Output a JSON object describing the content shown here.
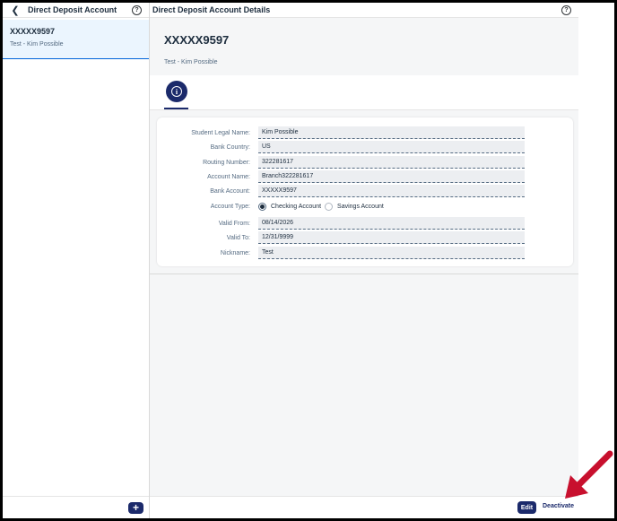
{
  "left_pane": {
    "title": "Direct Deposit Account",
    "items": [
      {
        "title": "XXXXX9597",
        "subtitle": "Test - Kim Possible"
      }
    ]
  },
  "right_pane": {
    "title": "Direct Deposit Account Details",
    "object_title": "XXXXX9597",
    "object_subtitle": "Test - Kim Possible"
  },
  "form": {
    "student_legal_name": {
      "label": "Student Legal Name:",
      "value": "Kim Possible"
    },
    "bank_country": {
      "label": "Bank Country:",
      "value": "US"
    },
    "routing_number": {
      "label": "Routing Number:",
      "value": "322281617"
    },
    "account_name": {
      "label": "Account Name:",
      "value": "Branch322281617"
    },
    "bank_account": {
      "label": "Bank Account:",
      "value": "XXXXX9597"
    },
    "account_type": {
      "label": "Account Type:",
      "options": [
        "Checking Account",
        "Savings Account"
      ],
      "selected": "Checking Account"
    },
    "valid_from": {
      "label": "Valid From:",
      "value": "08/14/2026"
    },
    "valid_to": {
      "label": "Valid To:",
      "value": "12/31/9999"
    },
    "nickname": {
      "label": "Nickname:",
      "value": "Test"
    }
  },
  "footer": {
    "edit_label": "Edit",
    "deactivate_label": "Deactivate"
  },
  "colors": {
    "brand": "#1b2a6b",
    "selected_bg": "#ebf5fe",
    "annotation_arrow": "#c8102e"
  },
  "icons": {
    "back": "chevron-left-icon",
    "help": "help-icon",
    "info": "info-icon",
    "add": "add-icon"
  }
}
